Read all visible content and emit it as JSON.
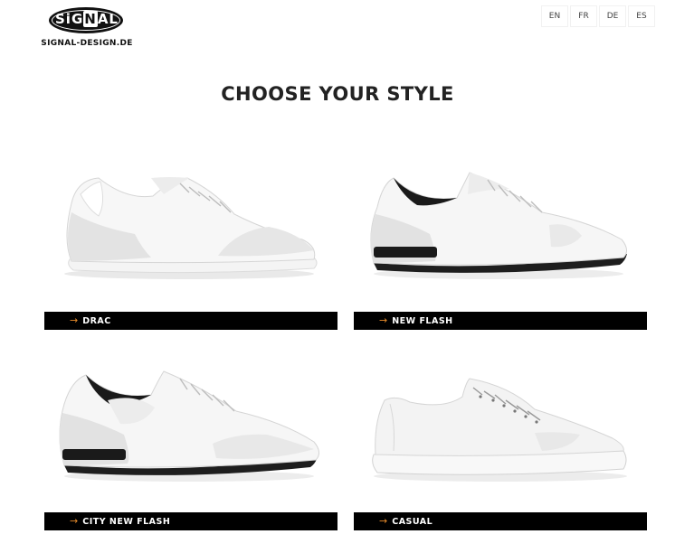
{
  "brand": {
    "logo_text_pre": "SiG",
    "logo_text_mid": "N",
    "logo_text_post": "AL",
    "url": "SIGNAL-DESIGN.DE"
  },
  "languages": [
    "EN",
    "FR",
    "DE",
    "ES"
  ],
  "title": "CHOOSE YOUR STYLE",
  "products": [
    {
      "label": "DRAC"
    },
    {
      "label": "NEW FLASH"
    },
    {
      "label": "CITY NEW FLASH"
    },
    {
      "label": "CASUAL"
    }
  ],
  "colors": {
    "accent": "#e58a2a",
    "bar": "#000000",
    "text": "#222222"
  },
  "icons": {
    "arrow": "→"
  }
}
